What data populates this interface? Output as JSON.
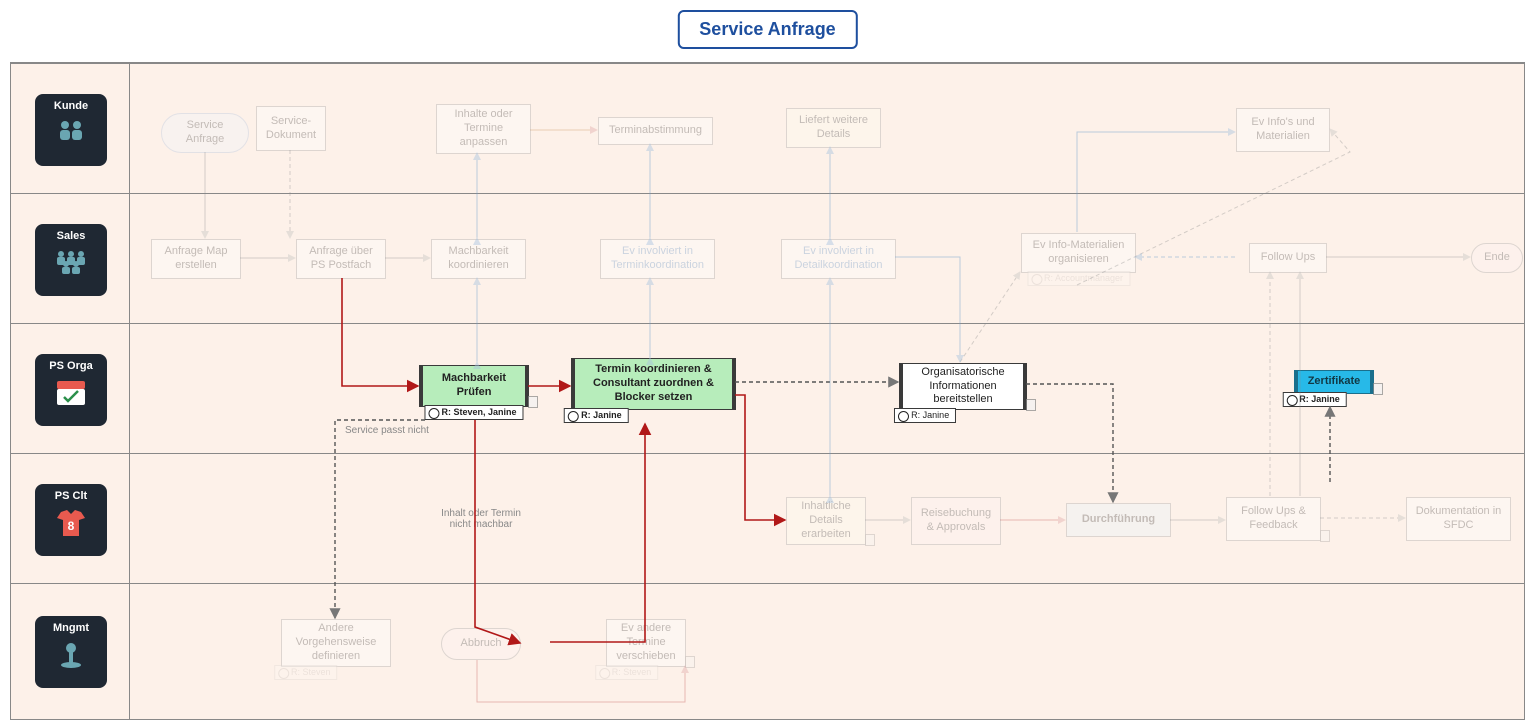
{
  "title": "Service Anfrage",
  "lanes": {
    "kunde": "Kunde",
    "sales": "Sales",
    "psorga": "PS Orga",
    "psclt": "PS Clt",
    "mngmt": "Mngmt"
  },
  "nodes": {
    "service_anfrage": "Service Anfrage",
    "service_dokument": "Service-Dokument",
    "inhalte_termine": "Inhalte oder Termine anpassen",
    "terminabstimmung": "Terminabstimmung",
    "liefert_details": "Liefert weitere Details",
    "ev_infos_mat": "Ev Info's und Materialien",
    "anfrage_map": "Anfrage Map erstellen",
    "anfrage_ps": "Anfrage über PS Postfach",
    "machbarkeit_koord": "Machbarkeit koordinieren",
    "ev_terminkoord": "Ev involviert in Terminkoordination",
    "ev_detailkoord": "Ev involviert in Detailkoordination",
    "ev_info_org": "Ev Info-Materialien organisieren",
    "ev_info_org_tag": "R: Accountmanager",
    "follow_ups": "Follow Ups",
    "ende": "Ende",
    "mach_prufen": "Machbarkeit Prüfen",
    "mach_prufen_tag": "R: Steven, Janine",
    "termin_koord": "Termin koordinieren & Consultant zuordnen & Blocker setzen",
    "termin_koord_tag": "R: Janine",
    "org_info": "Organisatorische Informationen bereitstellen",
    "org_info_tag": "R: Janine",
    "zertifikate": "Zertifikate",
    "zertifikate_tag": "R: Janine",
    "machbar_label": "Inhalt oder Termin nicht machbar",
    "service_passt_nicht": "Service passt nicht",
    "inhalt_details": "Inhaltliche Details erarbeiten",
    "reise": "Reisebuchung & Approvals",
    "durchfuehrung": "Durchführung",
    "followup_fb": "Follow Ups & Feedback",
    "doku_sfdc": "Dokumentation in SFDC",
    "andere_vg": "Andere Vorgehensweise definieren",
    "andere_vg_tag": "R: Steven",
    "abbruch": "Abbruch",
    "ev_termine_versch": "Ev andere Termine verschieben",
    "ev_termine_versch_tag": "R: Steven"
  }
}
